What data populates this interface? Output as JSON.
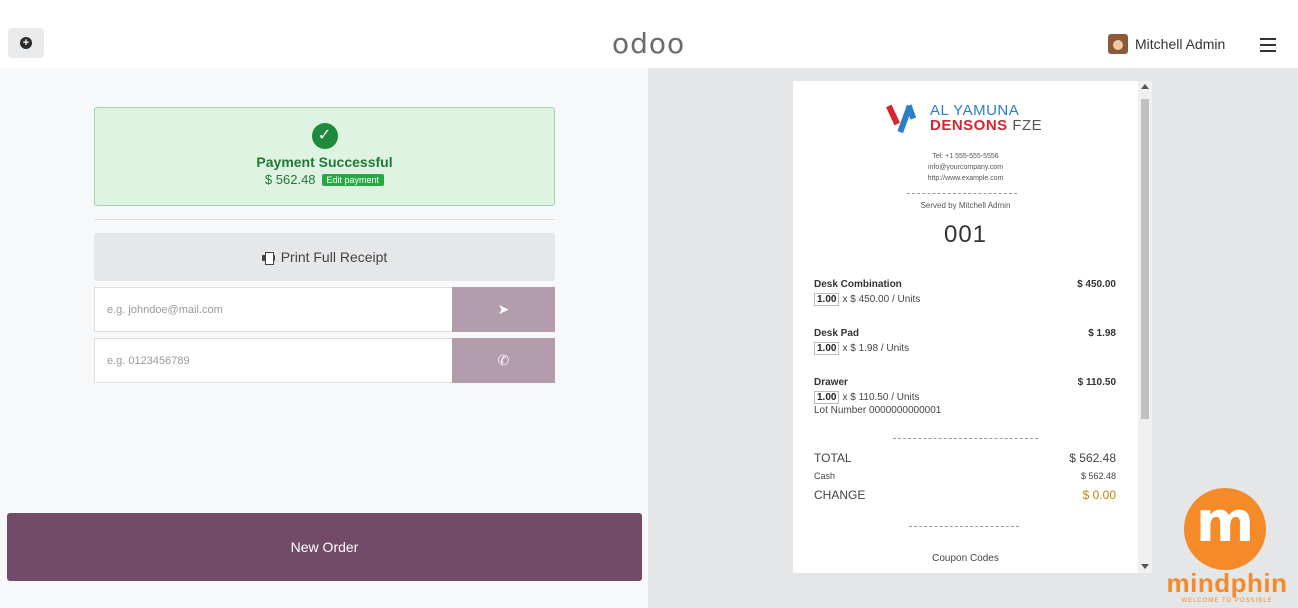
{
  "topbar": {
    "logo": "odoo",
    "user_name": "Mitchell Admin"
  },
  "payment": {
    "title": "Payment Successful",
    "amount": "$ 562.48",
    "edit_label": "Edit payment"
  },
  "actions": {
    "print_label": "Print Full Receipt",
    "email_placeholder": "e.g. johndoe@mail.com",
    "phone_placeholder": "e.g. 0123456789",
    "new_order_label": "New Order"
  },
  "receipt": {
    "brand_line1": "AL YAMUNA",
    "brand_line2": "DENSONS",
    "brand_suffix": "FZE",
    "contact_tel": "Tel: +1 555-555-5556",
    "contact_email": "info@yourcompany.com",
    "contact_web": "http://www.example.com",
    "served_by": "Served by Mitchell Admin",
    "order_number": "001",
    "lines": [
      {
        "name": "Desk Combination",
        "price": "$ 450.00",
        "qty": "1.00",
        "unit": "x $ 450.00 / Units",
        "lot": ""
      },
      {
        "name": "Desk Pad",
        "price": "$ 1.98",
        "qty": "1.00",
        "unit": "x $ 1.98 / Units",
        "lot": ""
      },
      {
        "name": "Drawer",
        "price": "$ 110.50",
        "qty": "1.00",
        "unit": "x $ 110.50 / Units",
        "lot": "Lot Number 0000000000001"
      }
    ],
    "total_label": "TOTAL",
    "total_value": "$ 562.48",
    "cash_label": "Cash",
    "cash_value": "$ 562.48",
    "change_label": "CHANGE",
    "change_value": "$ 0.00",
    "coupon_label": "Coupon Codes"
  },
  "watermark": {
    "letter": "m",
    "name": "mindphin",
    "tagline": "WELCOME TO POSSIBLE"
  },
  "colors": {
    "primary": "#714b67",
    "success": "#28a745",
    "send_button": "#b39cac",
    "watermark": "#f48a28"
  }
}
